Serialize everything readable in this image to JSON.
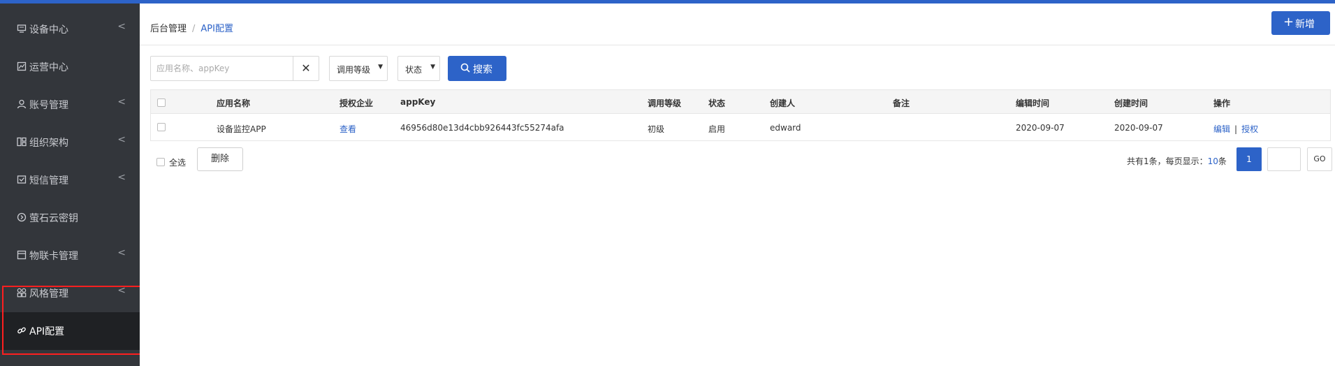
{
  "sidebar": {
    "items": [
      {
        "label": "设备中心",
        "icon": "monitor-icon",
        "has_submenu": true
      },
      {
        "label": "运营中心",
        "icon": "chart-icon",
        "has_submenu": false
      },
      {
        "label": "账号管理",
        "icon": "user-icon",
        "has_submenu": true
      },
      {
        "label": "组织架构",
        "icon": "org-icon",
        "has_submenu": true
      },
      {
        "label": "短信管理",
        "icon": "message-icon",
        "has_submenu": true
      },
      {
        "label": "萤石云密钥",
        "icon": "key-icon",
        "has_submenu": false
      },
      {
        "label": "物联卡管理",
        "icon": "card-icon",
        "has_submenu": true
      },
      {
        "label": "风格管理",
        "icon": "grid-icon",
        "has_submenu": true
      },
      {
        "label": "API配置",
        "icon": "link-icon",
        "has_submenu": false,
        "active": true
      }
    ],
    "chevron": "<"
  },
  "breadcrumb": {
    "root": "后台管理",
    "separator": "/",
    "current": "API配置"
  },
  "header": {
    "add_label": "新增",
    "add_icon": "plus-icon"
  },
  "filters": {
    "search_placeholder": "应用名称、appKey",
    "search_value": "",
    "level_select": "调用等级",
    "status_select": "状态",
    "search_button": "搜索"
  },
  "table": {
    "columns": [
      "应用名称",
      "授权企业",
      "appKey",
      "调用等级",
      "状态",
      "创建人",
      "备注",
      "编辑时间",
      "创建时间",
      "操作"
    ],
    "rows": [
      {
        "app_name": "设备监控APP",
        "auth_company": "查看",
        "app_key": "46956d80e13d4cbb926443fc55274afa",
        "level": "初级",
        "status": "启用",
        "creator": "edward",
        "remark": "",
        "edit_time": "2020-09-07",
        "create_time": "2020-09-07",
        "op_edit": "编辑",
        "op_sep": "|",
        "op_auth": "授权"
      }
    ]
  },
  "footer": {
    "select_all": "全选",
    "delete_button": "删除",
    "page_info_prefix": "共有1条，每页显示：",
    "page_size": "10",
    "page_info_suffix": "条",
    "current_page": "1",
    "go_button": "GO"
  },
  "colors": {
    "accent": "#2d63c8",
    "sidebar_bg": "#33363b",
    "sidebar_active": "#1f2124",
    "highlight": "#ff1f1f"
  }
}
